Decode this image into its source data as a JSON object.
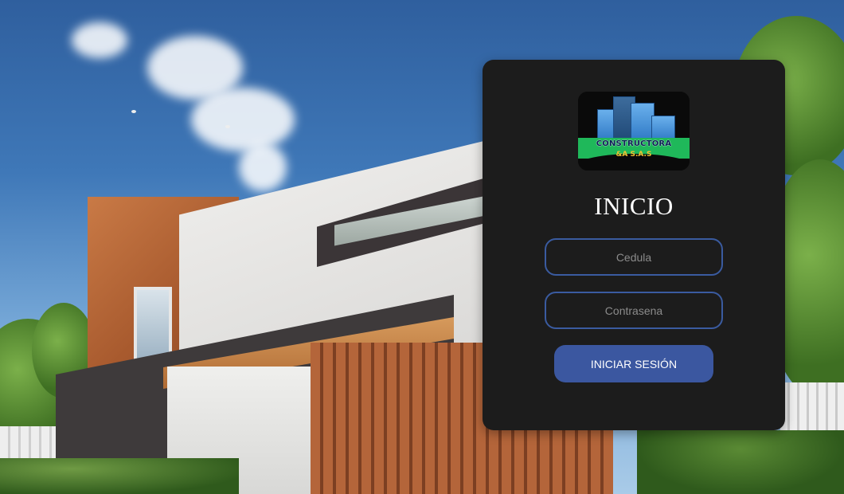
{
  "background": {
    "icon": "house-photo"
  },
  "login": {
    "logo": {
      "icon": "constructora-logo",
      "name": "CONSTRUCTORA",
      "suffix": "&A S.A.S"
    },
    "title": "INICIO",
    "cedula_placeholder": "Cedula",
    "password_placeholder": "Contrasena",
    "submit_label": "INICIAR SESIÓN"
  },
  "colors": {
    "card_background": "#1c1c1c",
    "field_border": "#3a5ba0",
    "button_background": "#3b57a0",
    "title_text": "#ffffff"
  }
}
